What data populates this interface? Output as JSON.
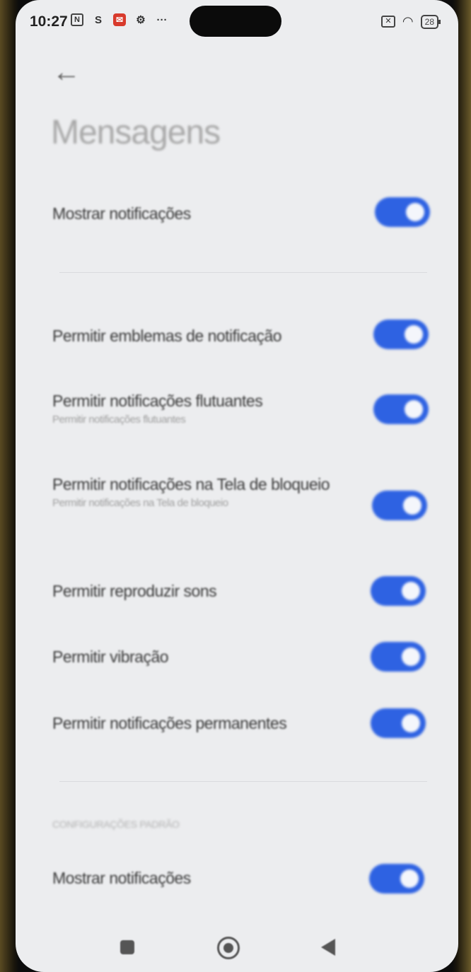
{
  "status_bar": {
    "time": "10:27",
    "left_icons": [
      "nfc-icon",
      "s-app-icon",
      "mail-app-icon",
      "settings-gear-icon",
      "more-dots-icon"
    ],
    "battery": "28",
    "right_icons": [
      "sim-x-icon",
      "wifi-icon",
      "battery-icon"
    ]
  },
  "header": {
    "back_icon": "back-arrow-icon",
    "title": "Mensagens"
  },
  "settings": [
    {
      "label": "Mostrar notificações",
      "enabled": true
    },
    {
      "label": "Permitir emblemas de notificação",
      "enabled": true
    },
    {
      "label": "Permitir notificações flutuantes",
      "sub": "Permitir notificações flutuantes",
      "enabled": true
    },
    {
      "label": "Permitir notificações na Tela de bloqueio",
      "sub": "Permitir notificações na Tela de bloqueio",
      "enabled": true
    },
    {
      "label": "Permitir reproduzir sons",
      "enabled": true
    },
    {
      "label": "Permitir vibração",
      "enabled": true
    },
    {
      "label": "Permitir notificações permanentes",
      "enabled": true
    }
  ],
  "default_section": {
    "header": "CONFIGURAÇÕES PADRÃO",
    "items": [
      {
        "label": "Mostrar notificações",
        "enabled": true
      }
    ]
  },
  "nav_bar": [
    "recents-square-icon",
    "home-circle-icon",
    "back-triangle-icon"
  ],
  "colors": {
    "toggle_on": "#2e62e2",
    "background": "#ecedef"
  }
}
